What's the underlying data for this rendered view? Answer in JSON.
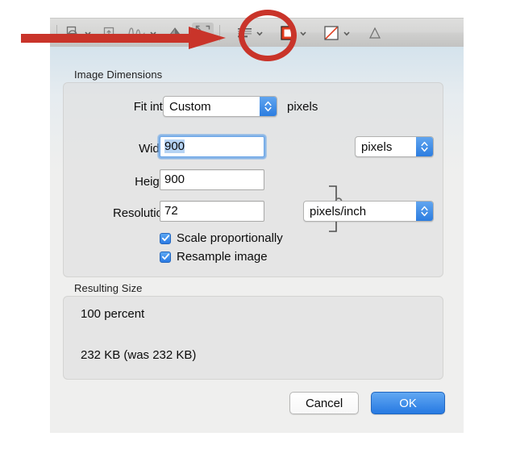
{
  "toolbar": {
    "items": [
      {
        "name": "shapes-tool",
        "icon": "shapes-icon",
        "has_chevron": true
      },
      {
        "name": "crop-tool",
        "icon": "crop-icon",
        "has_chevron": false
      },
      {
        "name": "sign-tool",
        "icon": "signature-icon",
        "has_chevron": true
      },
      {
        "name": "adjust-color-tool",
        "icon": "adjust-color-icon",
        "has_chevron": false
      },
      {
        "name": "adjust-size-tool",
        "icon": "expand-arrows-icon",
        "has_chevron": false
      },
      {
        "name": "text-style-tool",
        "icon": "text-lines-icon",
        "has_chevron": true
      },
      {
        "name": "border-color-tool",
        "icon": "border-square-icon",
        "has_chevron": true
      },
      {
        "name": "fill-color-tool",
        "icon": "no-fill-square-icon",
        "has_chevron": true
      },
      {
        "name": "text-tool",
        "icon": "letter-a-icon",
        "has_chevron": false
      }
    ]
  },
  "annotations": {
    "arrow_color": "#c9342a",
    "circle_color": "#c9342a",
    "highlighted_tool": "adjust-size-tool"
  },
  "dialog": {
    "image_dimensions": {
      "group_label": "Image Dimensions",
      "fit_into": {
        "label": "Fit into:",
        "value": "Custom",
        "unit_suffix": "pixels"
      },
      "width": {
        "label": "Width:",
        "value": "900",
        "selected": true
      },
      "height": {
        "label": "Height:",
        "value": "900"
      },
      "size_unit": {
        "value": "pixels"
      },
      "resolution": {
        "label": "Resolution:",
        "value": "72"
      },
      "resolution_unit": {
        "value": "pixels/inch"
      },
      "lock_icon": "closed-padlock-icon",
      "checkboxes": [
        {
          "label": "Scale proportionally",
          "checked": true
        },
        {
          "label": "Resample image",
          "checked": true
        }
      ]
    },
    "resulting_size": {
      "group_label": "Resulting Size",
      "percent_line": "100 percent",
      "bytes_line": "232 KB (was 232 KB)"
    },
    "buttons": {
      "cancel": "Cancel",
      "ok": "OK"
    }
  },
  "colors": {
    "accent_blue": "#2c7de0",
    "annotation_red": "#c9342a",
    "dialog_bg": "#efefee",
    "selection_blue": "#b5d3f4"
  }
}
